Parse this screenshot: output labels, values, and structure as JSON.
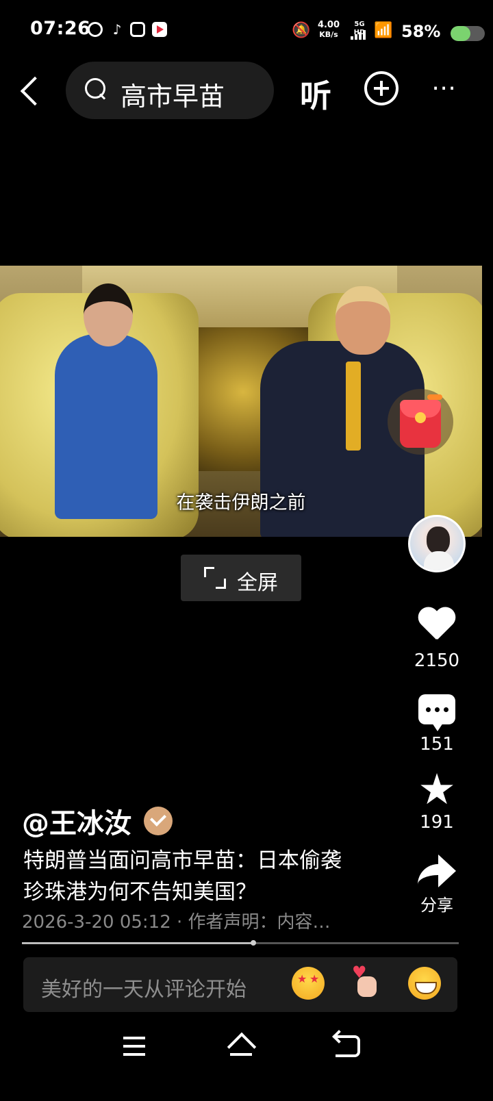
{
  "status_bar": {
    "time": "07:26",
    "net_speed_value": "4.00",
    "net_speed_unit": "KB/s",
    "network": "5G HD",
    "battery_percent_text": "58%",
    "battery_level": 0.58,
    "app_icons": [
      "app-icon-1",
      "tiktok-icon",
      "app-icon-3",
      "app-icon-4"
    ]
  },
  "top_nav": {
    "search_query": "高市早苗",
    "listen_label": "听",
    "more_label": "⋯"
  },
  "video": {
    "subtitle": "在袭击伊朗之前"
  },
  "fullscreen": {
    "label": "全屏"
  },
  "actions": {
    "like_count": "2150",
    "comment_count": "151",
    "favorite_count": "191",
    "share_label": "分享"
  },
  "post": {
    "author": "@王冰汝",
    "title": "特朗普当面问高市早苗：日本偷袭珍珠港为何不告知美国？",
    "meta": "2026-3-20 05:12 · 作者声明：内容…",
    "progress": 0.53
  },
  "comment_bar": {
    "placeholder": "美好的一天从评论开始",
    "emojis": [
      "star-eyes-emoji",
      "finger-heart-emoji",
      "grin-emoji"
    ]
  },
  "colors": {
    "background": "#000000",
    "battery_fill": "#7bd36f",
    "red_packet": "#e8333f",
    "verified_badge": "#d9a77a"
  }
}
